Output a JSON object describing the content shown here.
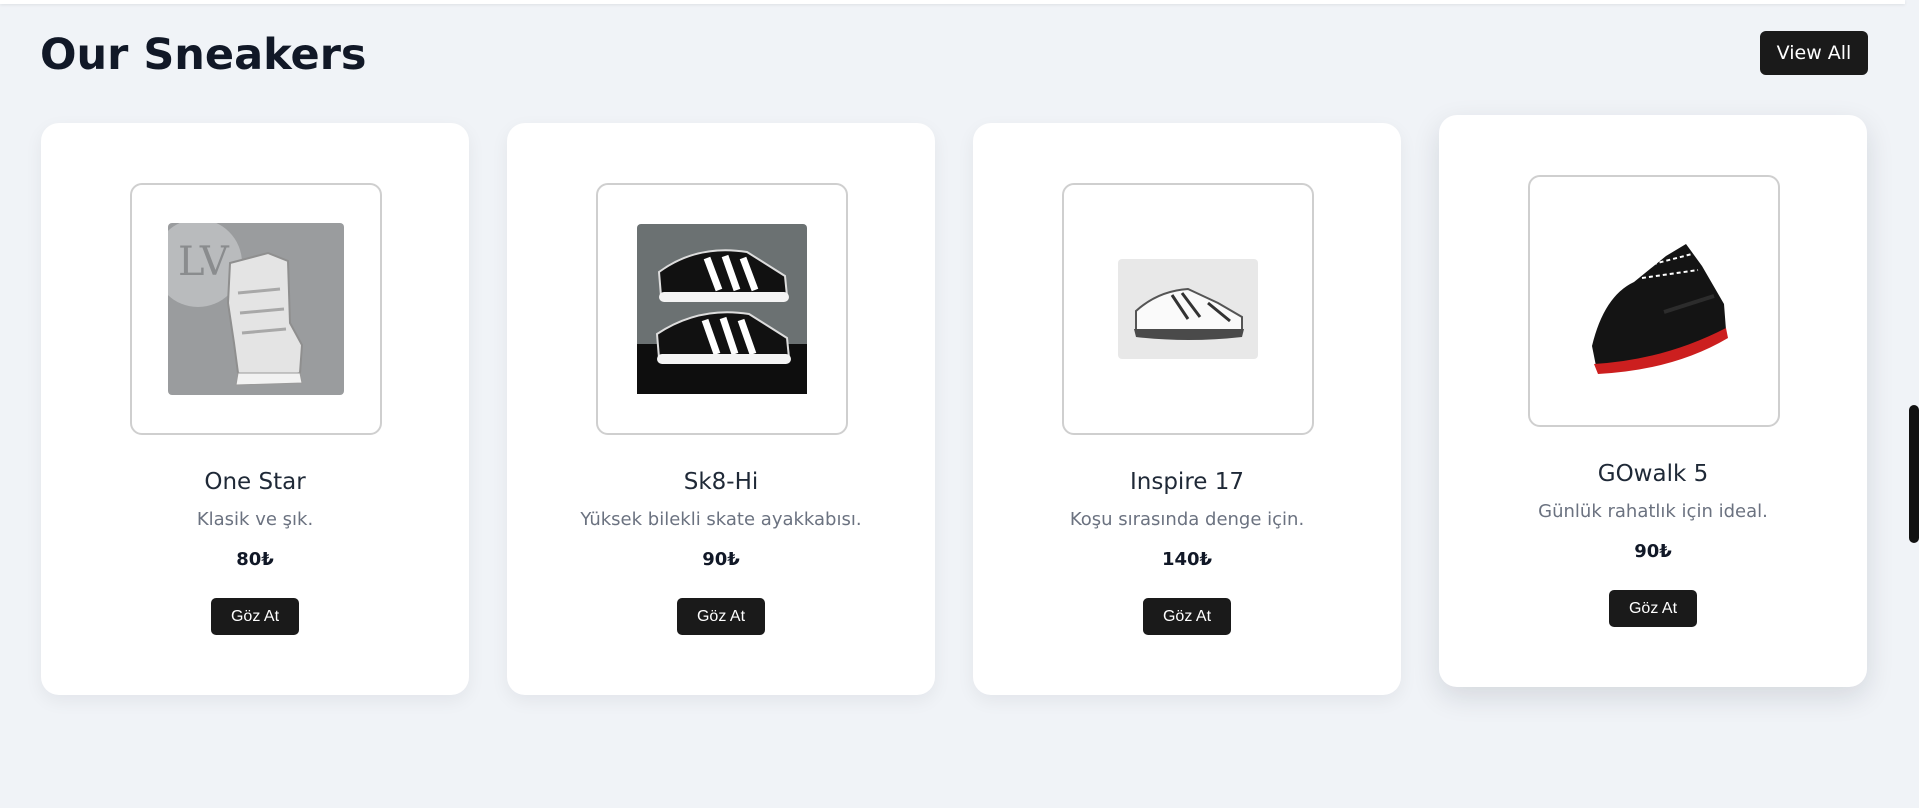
{
  "section": {
    "title": "Our Sneakers",
    "view_all_label": "View All"
  },
  "products": [
    {
      "name": "One Star",
      "description": "Klasik ve şık.",
      "price": "80₺",
      "button_label": "Göz At",
      "icon": "high-top-sneaker-image"
    },
    {
      "name": "Sk8-Hi",
      "description": "Yüksek bilekli skate ayakkabısı.",
      "price": "90₺",
      "button_label": "Göz At",
      "icon": "striped-sneakers-image"
    },
    {
      "name": "Inspire 17",
      "description": "Koşu sırasında denge için.",
      "price": "140₺",
      "button_label": "Göz At",
      "icon": "white-running-shoe-image"
    },
    {
      "name": "GOwalk 5",
      "description": "Günlük rahatlık için ideal.",
      "price": "90₺",
      "button_label": "Göz At",
      "icon": "black-red-sneaker-image"
    }
  ],
  "colors": {
    "background": "#f0f3f7",
    "button": "#1a1a1a",
    "card": "#ffffff"
  }
}
